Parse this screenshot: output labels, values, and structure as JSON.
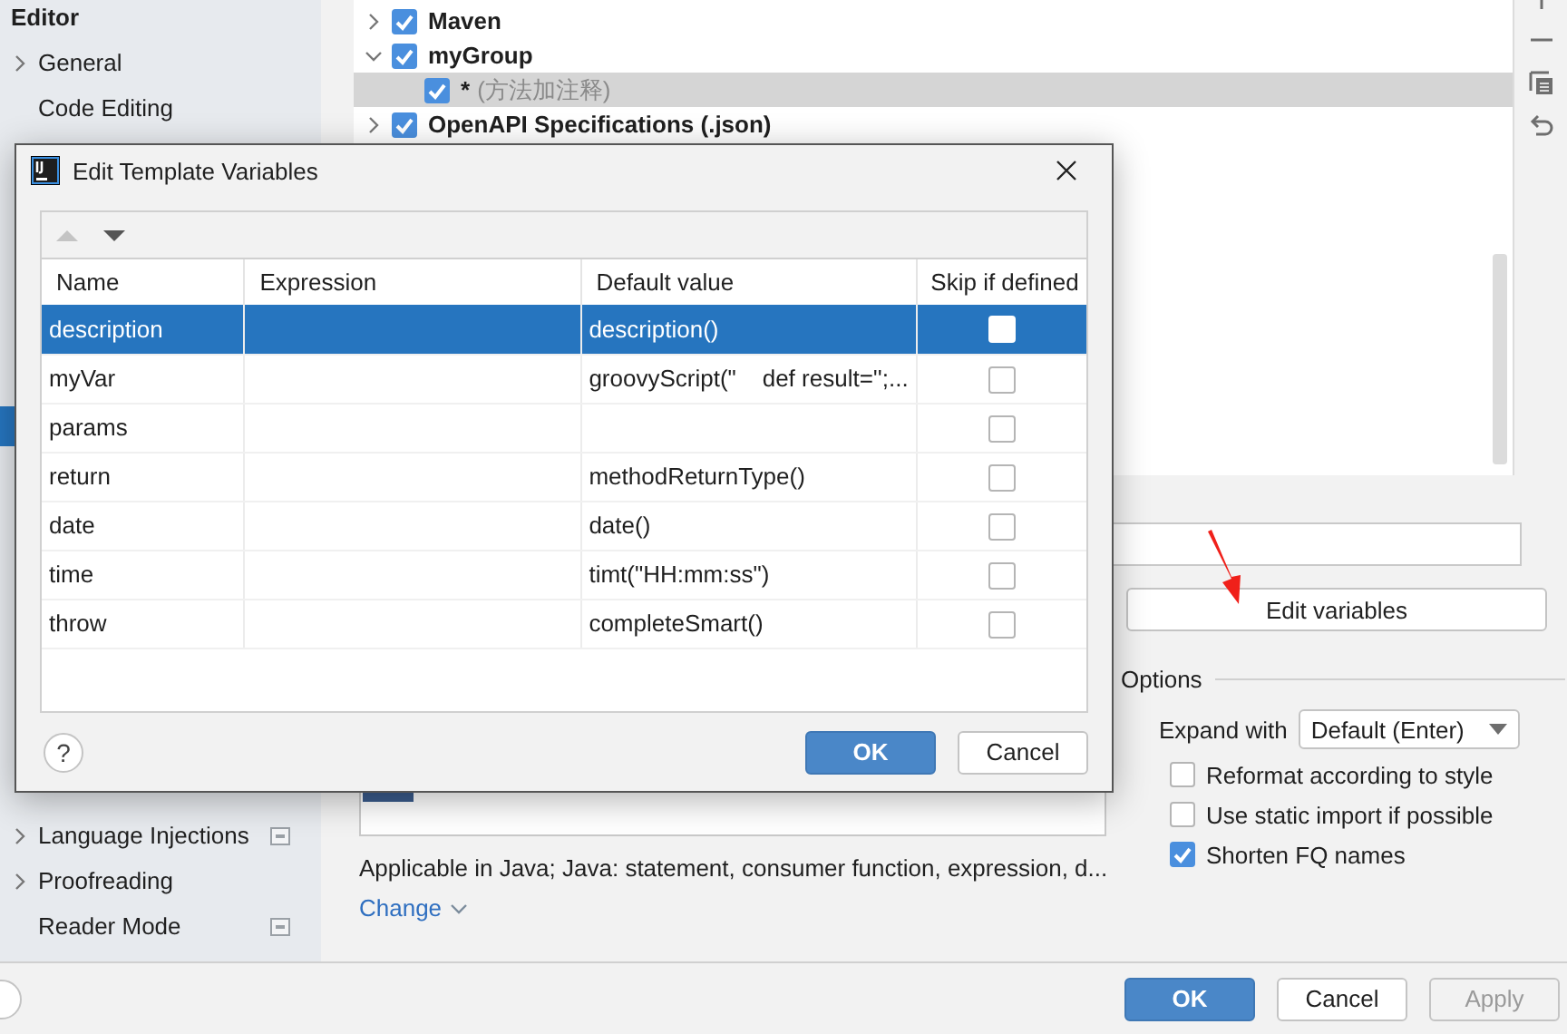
{
  "sidebar": {
    "items": [
      {
        "label": "Editor",
        "kind": "heading",
        "selected": false
      },
      {
        "label": "General",
        "kind": "expandable",
        "selected": false
      },
      {
        "label": "Code Editing",
        "kind": "plain",
        "selected": false
      },
      {
        "kind": "plain",
        "selected": true
      },
      {
        "label": "Language Injections",
        "kind": "expandable",
        "selected": false,
        "project_icon": true
      },
      {
        "label": "Proofreading",
        "kind": "expandable",
        "selected": false
      },
      {
        "label": "Reader Mode",
        "kind": "plain",
        "selected": false,
        "project_icon": true
      }
    ]
  },
  "template_tree": {
    "items": [
      {
        "label": "Maven",
        "checked": true,
        "expanded": false,
        "selected": false
      },
      {
        "label": "myGroup",
        "checked": true,
        "expanded": true,
        "selected": false,
        "children": [
          {
            "abbreviation": "*",
            "description": "(方法加注释)",
            "checked": true,
            "selected": true
          }
        ]
      },
      {
        "label": "OpenAPI Specifications (.json)",
        "checked": true,
        "expanded": false,
        "selected": false
      }
    ]
  },
  "template_editor": {
    "applicable": "Applicable in Java; Java: statement, consumer function, expression, d...",
    "change_link": "Change"
  },
  "edit_variables_button": "Edit variables",
  "options": {
    "title": "Options",
    "expand_with": {
      "label": "Expand with",
      "value": "Default (Enter)"
    },
    "checkboxes": [
      {
        "label": "Reformat according to style",
        "checked": false
      },
      {
        "label": "Use static import if possible",
        "checked": false
      },
      {
        "label": "Shorten FQ names",
        "checked": true
      }
    ]
  },
  "buttons": [
    {
      "label": "OK",
      "kind": "primary",
      "disabled": false
    },
    {
      "label": "Cancel",
      "kind": "default",
      "disabled": false
    },
    {
      "label": "Apply",
      "kind": "default",
      "disabled": true
    }
  ],
  "dialog": {
    "title": "Edit Template Variables",
    "toolbar": [
      {
        "kind": "up",
        "disabled": true
      },
      {
        "kind": "down",
        "disabled": false
      }
    ],
    "columns": [
      "Name",
      "Expression",
      "Default value",
      "Skip if defined"
    ],
    "rows": [
      {
        "name": "description",
        "default_value": "description()",
        "skip_if_defined": false,
        "selected": true
      },
      {
        "name": "myVar",
        "default_value": "groovyScript(\"    def result='';...",
        "skip_if_defined": false,
        "selected": false
      },
      {
        "name": "params",
        "skip_if_defined": false,
        "selected": false
      },
      {
        "name": "return",
        "default_value": "methodReturnType()",
        "skip_if_defined": false,
        "selected": false
      },
      {
        "name": "date",
        "default_value": "date()",
        "skip_if_defined": false,
        "selected": false
      },
      {
        "name": "time",
        "default_value": "timt(\"HH:mm:ss\")",
        "skip_if_defined": false,
        "selected": false
      },
      {
        "name": "throw",
        "default_value": "completeSmart()",
        "skip_if_defined": false,
        "selected": false
      }
    ],
    "help_label": "?",
    "buttons": [
      {
        "label": "OK",
        "kind": "primary"
      },
      {
        "label": "Cancel",
        "kind": "default"
      }
    ]
  }
}
